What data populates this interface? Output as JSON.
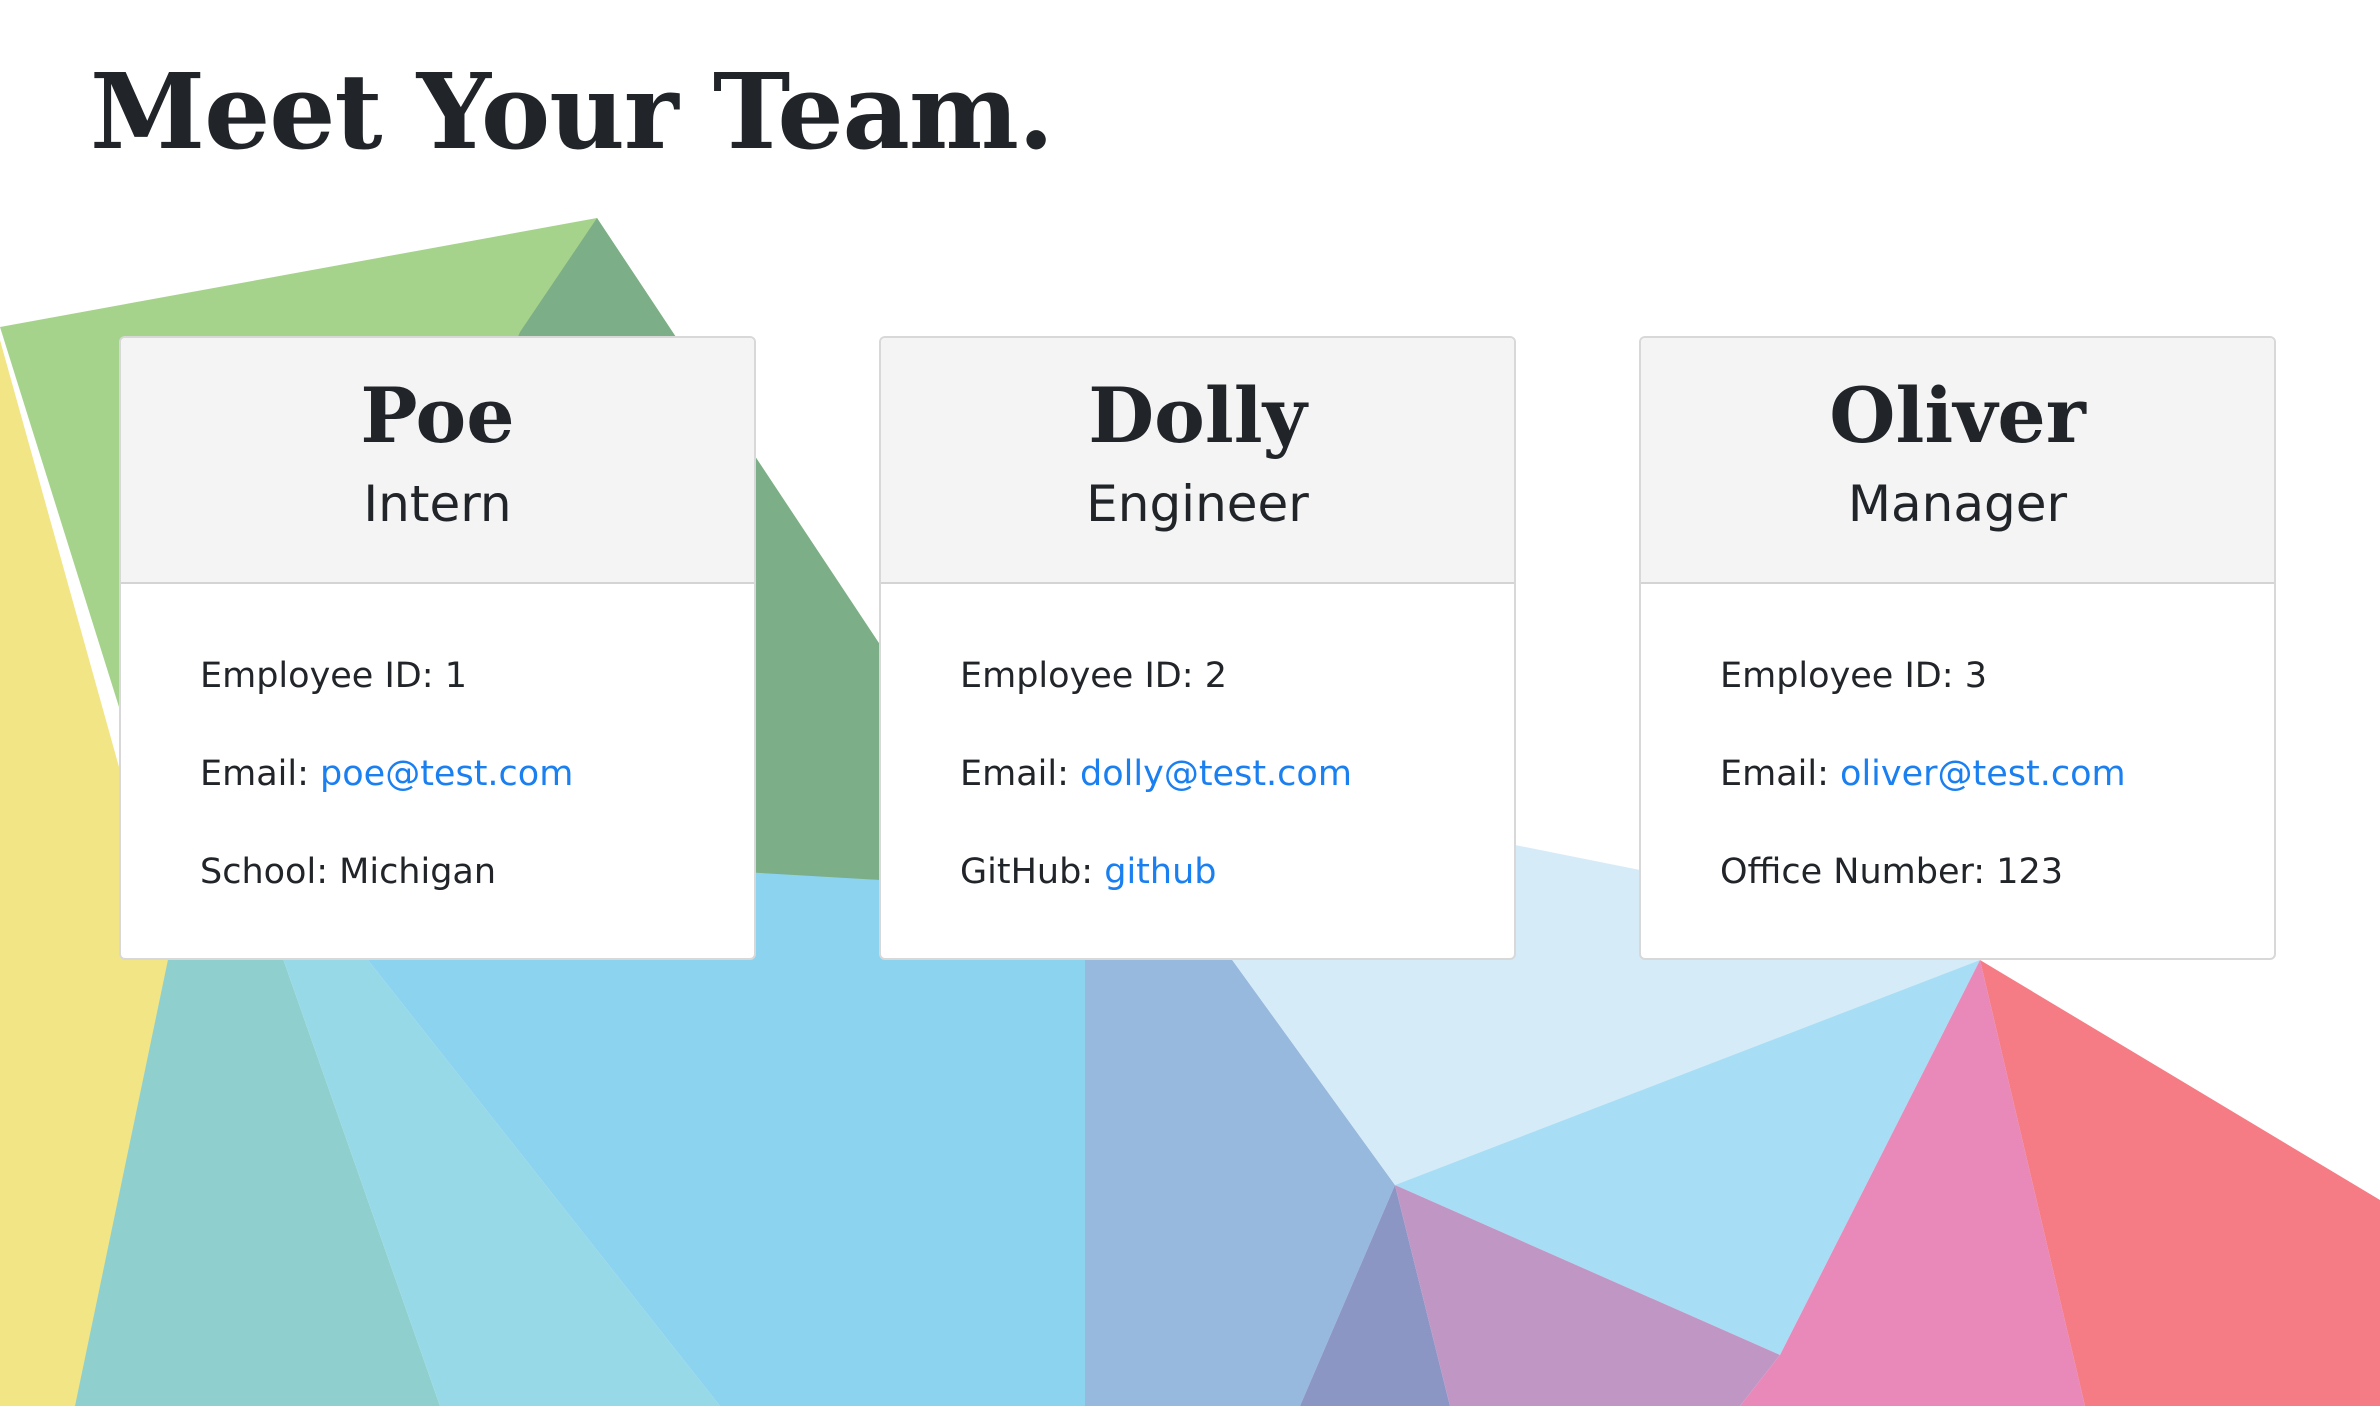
{
  "header": {
    "title": "Meet Your Team."
  },
  "colors": {
    "link": "#1a7ff0",
    "card_header_bg": "#f4f4f4",
    "text": "#212529"
  },
  "team": [
    {
      "name": "Poe",
      "role": "Intern",
      "id_label": "Employee ID:",
      "id_value": "1",
      "email_label": "Email:",
      "email": "poe@test.com",
      "extra_label": "School:",
      "extra_value": "Michigan"
    },
    {
      "name": "Dolly",
      "role": "Engineer",
      "id_label": "Employee ID:",
      "id_value": "2",
      "email_label": "Email:",
      "email": "dolly@test.com",
      "extra_label": "GitHub:",
      "extra_value": "github"
    },
    {
      "name": "Oliver",
      "role": "Manager",
      "id_label": "Employee ID:",
      "id_value": "3",
      "email_label": "Email:",
      "email": "oliver@test.com",
      "extra_label": "Office Number:",
      "extra_value": "123"
    }
  ]
}
